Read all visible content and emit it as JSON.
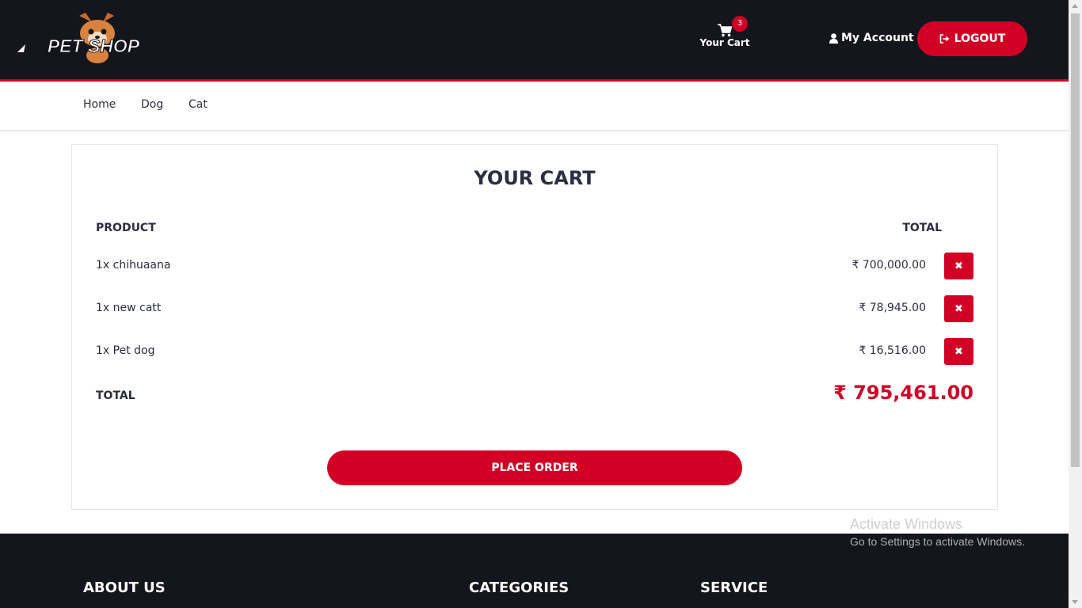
{
  "header": {
    "logo_text": "PET SHOP",
    "cart_label": "Your Cart",
    "cart_count": "3",
    "account_label": "My Account",
    "logout_label": "LOGOUT"
  },
  "nav": {
    "items": [
      {
        "label": "Home"
      },
      {
        "label": "Dog"
      },
      {
        "label": "Cat"
      }
    ]
  },
  "cart": {
    "title": "YOUR CART",
    "col_product": "PRODUCT",
    "col_total": "TOTAL",
    "items": [
      {
        "name": "1x chihuaana",
        "price": "₹ 700,000.00"
      },
      {
        "name": "1x new catt",
        "price": "₹ 78,945.00"
      },
      {
        "name": "1x Pet dog",
        "price": "₹ 16,516.00"
      }
    ],
    "total_label": "TOTAL",
    "total_value": "₹ 795,461.00",
    "place_order_label": "PLACE ORDER"
  },
  "footer": {
    "about_title": "ABOUT US",
    "categories_title": "CATEGORIES",
    "service_title": "SERVICE"
  },
  "watermark": {
    "title": "Activate Windows",
    "subtitle": "Go to Settings to activate Windows."
  },
  "colors": {
    "accent": "#d10024",
    "dark_bg": "#15161d",
    "text": "#2b2d42"
  }
}
